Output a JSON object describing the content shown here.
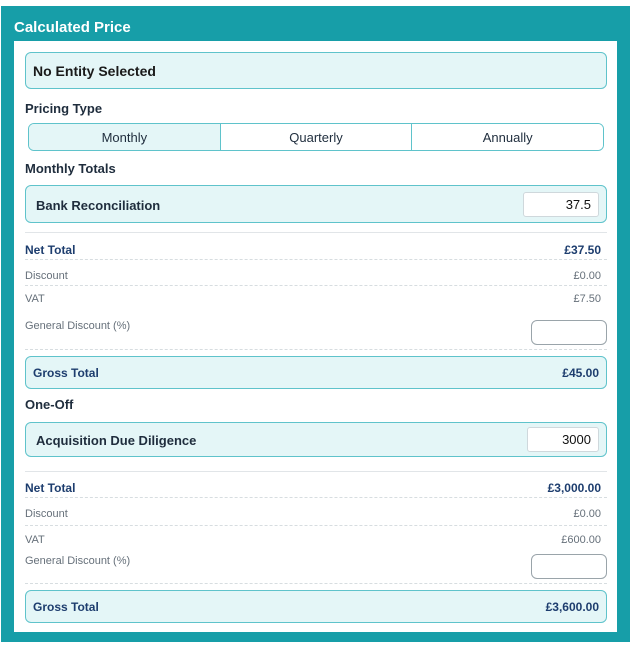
{
  "panel": {
    "title": "Calculated Price"
  },
  "entity": {
    "label": "No Entity Selected"
  },
  "pricing": {
    "heading": "Pricing Type",
    "tabs": [
      {
        "label": "Monthly",
        "active": true
      },
      {
        "label": "Quarterly",
        "active": false
      },
      {
        "label": "Annually",
        "active": false
      }
    ]
  },
  "monthly": {
    "heading": "Monthly Totals",
    "service": {
      "name": "Bank Reconciliation",
      "value": "37.5"
    },
    "net_total": {
      "label": "Net Total",
      "value": "£37.50"
    },
    "discount": {
      "label": "Discount",
      "value": "£0.00"
    },
    "vat": {
      "label": "VAT",
      "value": "£7.50"
    },
    "general_discount": {
      "label": "General Discount (%)",
      "value": ""
    },
    "gross_total": {
      "label": "Gross Total",
      "value": "£45.00"
    }
  },
  "oneoff": {
    "heading": "One-Off",
    "service": {
      "name": "Acquisition Due Diligence",
      "value": "3000"
    },
    "net_total": {
      "label": "Net Total",
      "value": "£3,000.00"
    },
    "discount": {
      "label": "Discount",
      "value": "£0.00"
    },
    "vat": {
      "label": "VAT",
      "value": "£600.00"
    },
    "general_discount": {
      "label": "General Discount (%)",
      "value": ""
    },
    "gross_total": {
      "label": "Gross Total",
      "value": "£3,600.00"
    }
  },
  "colors": {
    "accent": "#179ea8",
    "box_fill": "#e4f6f7",
    "box_border": "#5fc3cb",
    "total_text": "#1d3d6e"
  }
}
